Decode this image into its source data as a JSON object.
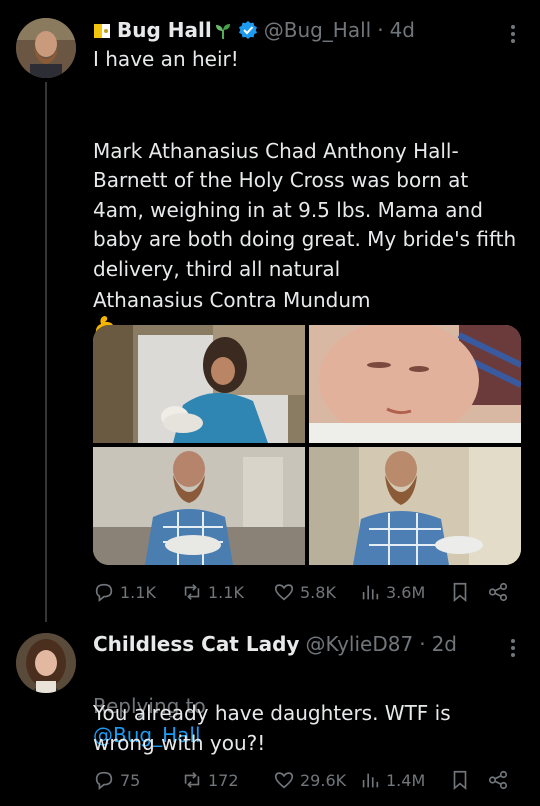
{
  "tweet": {
    "author_name": "Bug Hall",
    "author_handle": "@Bug_Hall",
    "separator": "·",
    "time": "4d",
    "verified": true,
    "first_line": "I have an heir!",
    "paragraph": "Mark Athanasius Chad Anthony Hall-Barnett of the Holy Cross was born at 4am, weighing in at 9.5 lbs. Mama and baby are both doing great. My bride's fifth delivery, third all natural",
    "closing": "Athanasius Contra Mundum",
    "emojis": [
      "flexed-biceps",
      "fleur-de-lis"
    ],
    "stats": {
      "replies": "1.1K",
      "reposts": "1.1K",
      "likes": "5.8K",
      "views": "3.6M"
    }
  },
  "reply": {
    "author_name": "Childless Cat Lady",
    "author_handle": "@KylieD87",
    "separator": "·",
    "time": "2d",
    "replying_prefix": "Replying to",
    "replying_handle": "@Bug_Hall",
    "text": "You already have daughters. WTF is wrong with you?!",
    "stats": {
      "replies": "75",
      "reposts": "172",
      "likes": "29.6K",
      "views": "1.4M"
    }
  },
  "colors": {
    "background": "#000000",
    "text": "#e7e9ea",
    "muted": "#71767b",
    "link": "#1d9bf0",
    "verified": "#1d9bf0"
  }
}
